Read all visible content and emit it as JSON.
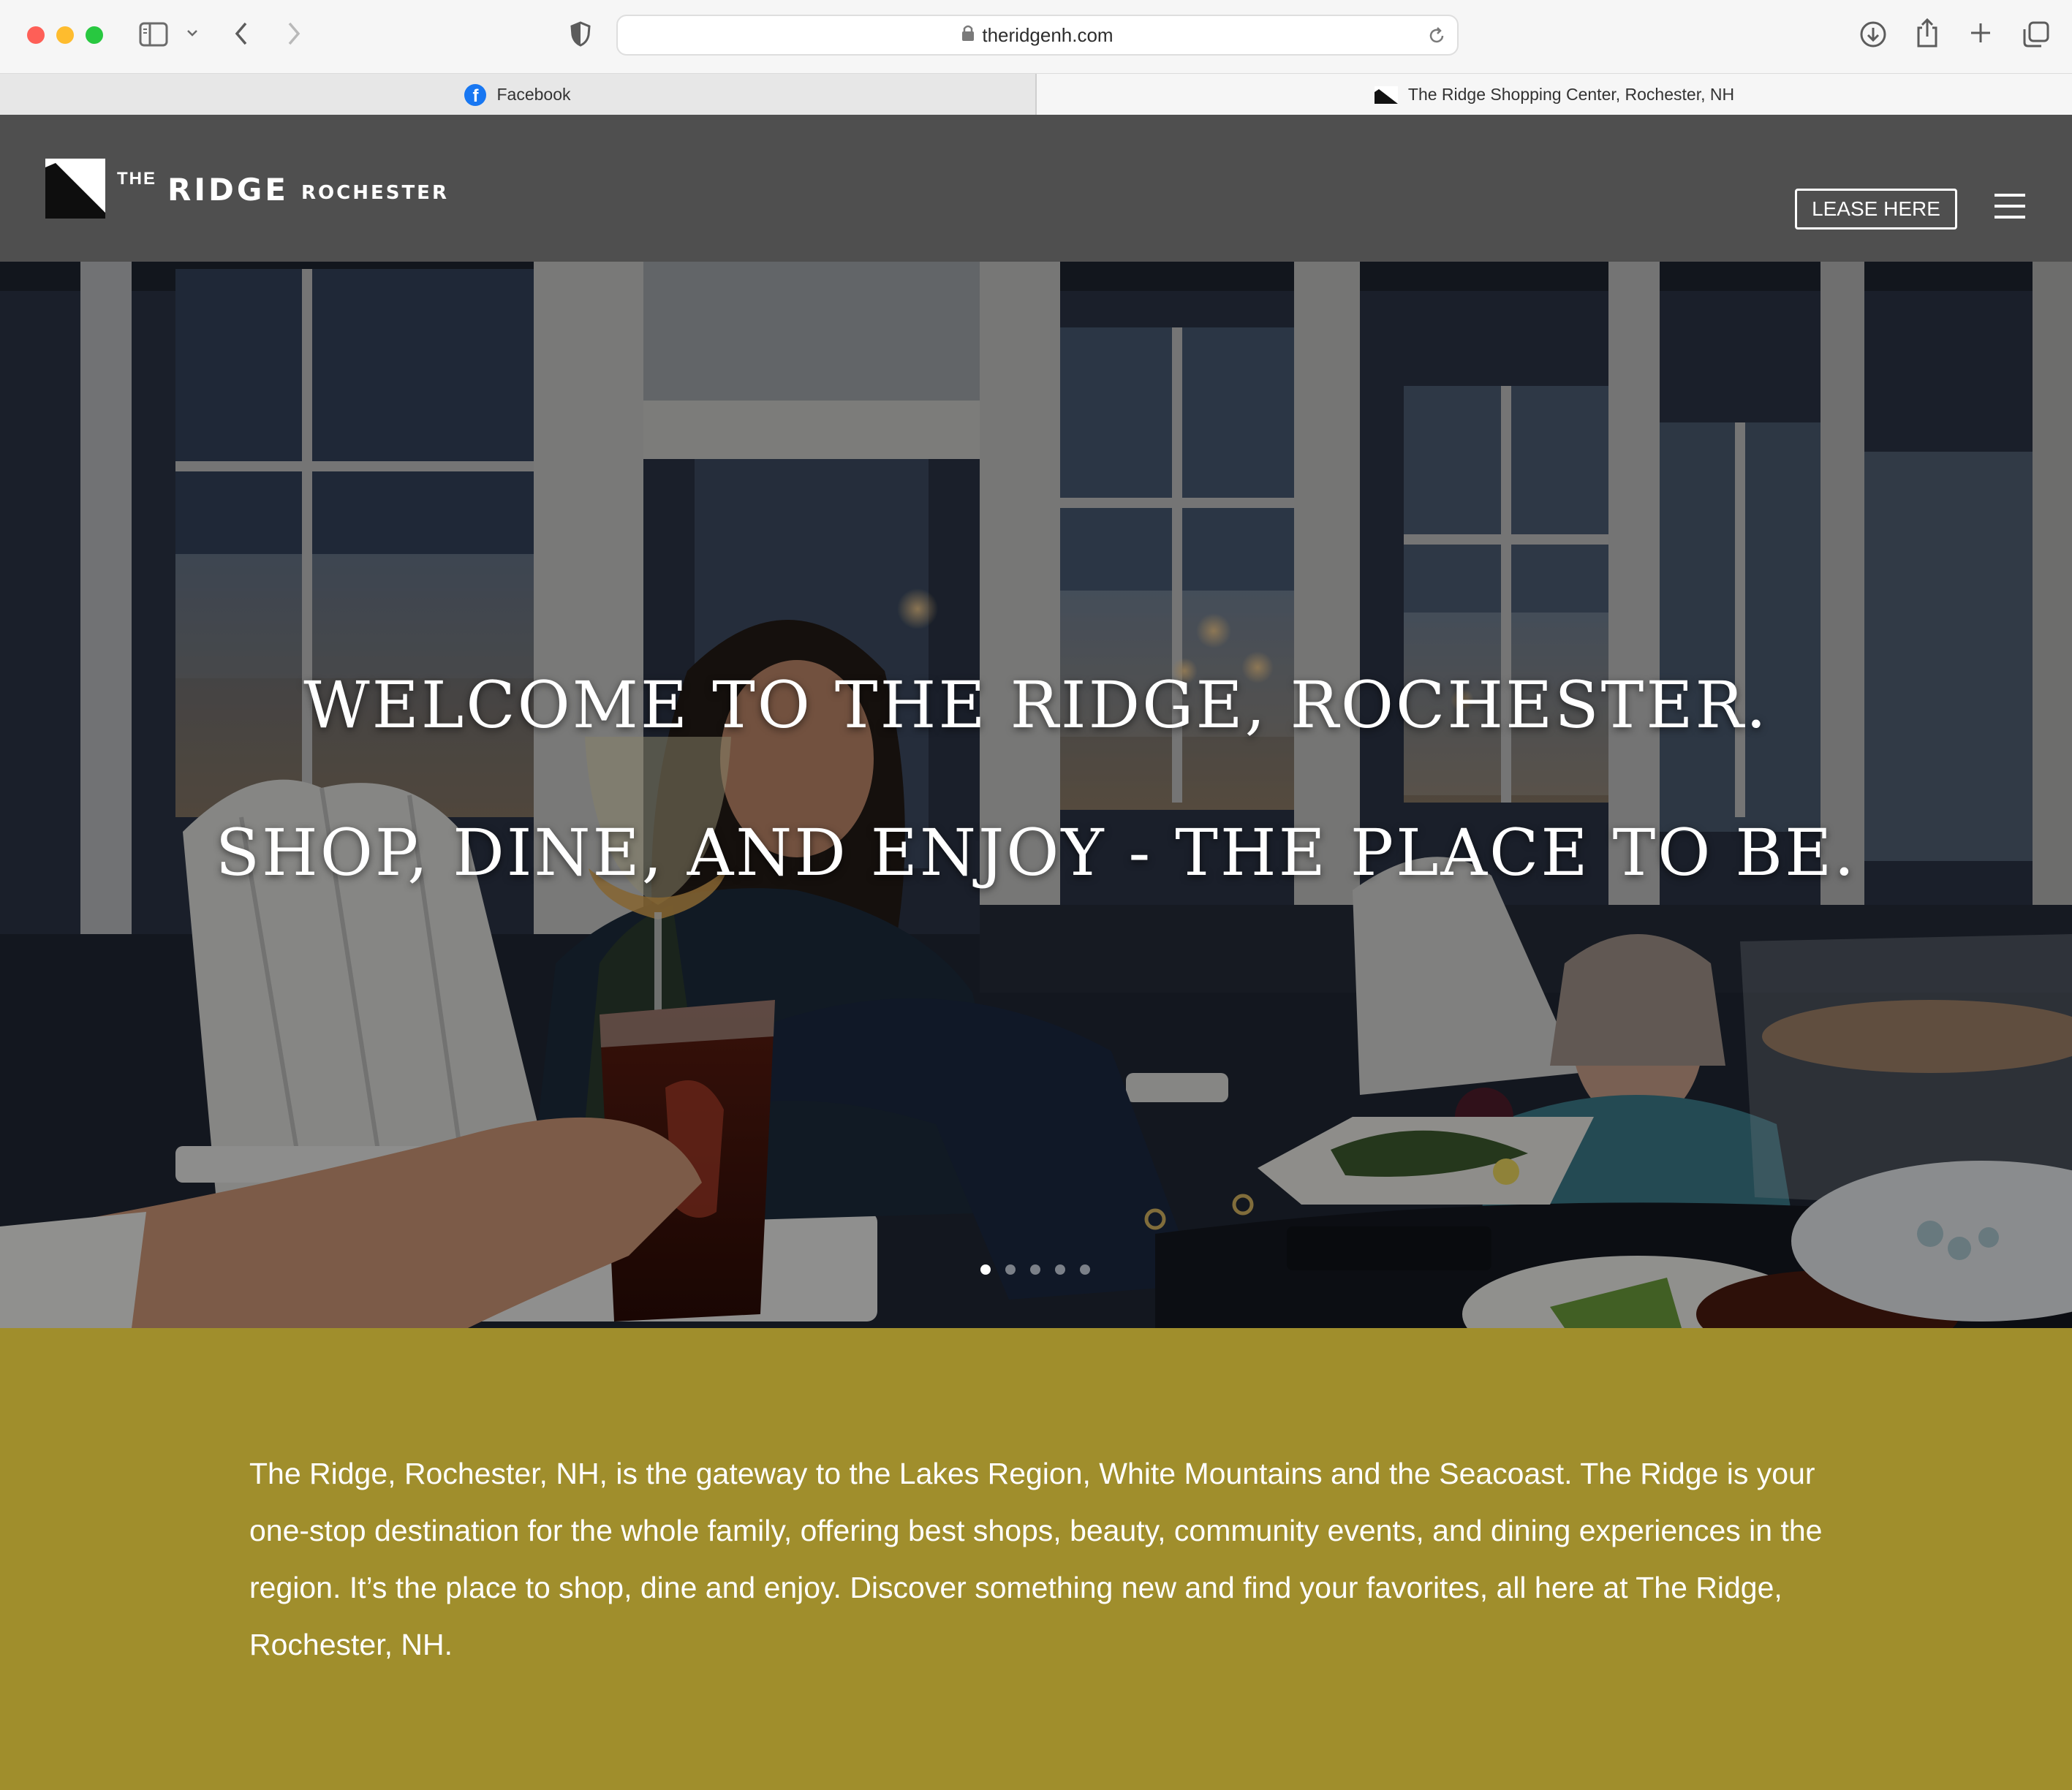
{
  "browser": {
    "url": "theridgenh.com",
    "tabs": [
      {
        "label": "Facebook",
        "icon": "facebook-icon",
        "active": false
      },
      {
        "label": "The Ridge Shopping Center, Rochester, NH",
        "icon": "ridge-favicon",
        "active": true
      }
    ]
  },
  "header": {
    "logo_the": "THE",
    "logo_ridge": "RIDGE",
    "logo_rochester": "ROCHESTER",
    "lease_button": "LEASE HERE",
    "menu_icon": "hamburger-menu-icon"
  },
  "hero": {
    "line1": "WELCOME TO THE RIDGE, ROCHESTER.",
    "line2": "SHOP, DINE, AND ENJOY - THE PLACE TO BE.",
    "slide_count": 5,
    "active_slide": 1
  },
  "intro": {
    "text": "The Ridge, Rochester, NH, is the gateway to the Lakes Region, White Mountains and the Seacoast. The Ridge is your one-stop destination for the whole family, offering best shops, beauty, community events, and dining experiences in the region. It’s the place to shop, dine and enjoy. Discover something new and find your favorites, all here at The Ridge, Rochester, NH."
  },
  "colors": {
    "header_bg": "#4f4f4f",
    "intro_bg": "#a08e2c",
    "accent_white": "#ffffff"
  }
}
